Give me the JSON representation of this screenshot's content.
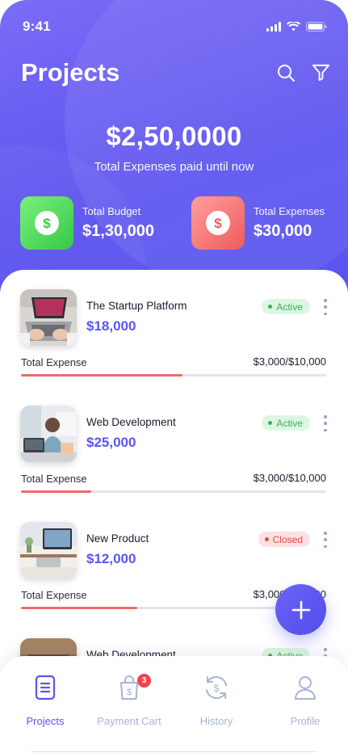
{
  "status": {
    "time": "9:41"
  },
  "header": {
    "title": "Projects"
  },
  "summary": {
    "amount": "$2,50,0000",
    "subtitle": "Total Expenses paid until now"
  },
  "stats": [
    {
      "label": "Total Budget",
      "value": "$1,30,000",
      "color": "#37c847"
    },
    {
      "label": "Total Expenses",
      "value": "$30,000",
      "color": "#ef5b5d"
    }
  ],
  "projects": [
    {
      "name": "The Startup Platform",
      "amount": "$18,000",
      "status": "Active",
      "expense_label": "Total Expense",
      "spent": "$3,000",
      "budget": "/$10,000",
      "progress": 0.53
    },
    {
      "name": "Web Development",
      "amount": "$25,000",
      "status": "Active",
      "expense_label": "Total Expense",
      "spent": "$3,000",
      "budget": "/$10,000",
      "progress": 0.23
    },
    {
      "name": "New Product",
      "amount": "$12,000",
      "status": "Closed",
      "expense_label": "Total Expense",
      "spent": "$3,000",
      "budget": "/$10,000",
      "progress": 0.38
    },
    {
      "name": "Web Development",
      "status": "Active"
    }
  ],
  "nav": [
    {
      "label": "Projects",
      "icon": "document-icon",
      "active": true
    },
    {
      "label": "Payment Cart",
      "icon": "shopping-bag-icon",
      "badge": "3"
    },
    {
      "label": "History",
      "icon": "history-icon"
    },
    {
      "label": "Profile",
      "icon": "user-icon"
    }
  ],
  "colors": {
    "primary": "#5a55f0",
    "active": "#3eae59",
    "closed": "#e24a4a"
  }
}
